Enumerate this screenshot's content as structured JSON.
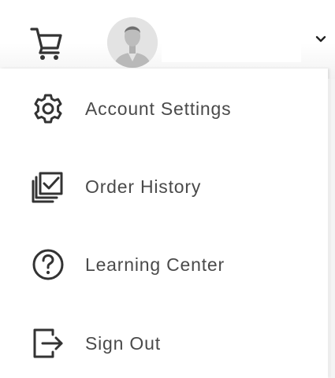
{
  "header": {
    "cart_icon": "shopping-cart-icon",
    "avatar_icon": "user-avatar-icon",
    "user_name": "",
    "dropdown_icon": "chevron-down-icon"
  },
  "menu": {
    "items": [
      {
        "label": "Account Settings",
        "icon": "gear-icon"
      },
      {
        "label": "Order History",
        "icon": "order-history-icon"
      },
      {
        "label": "Learning Center",
        "icon": "help-circle-icon"
      },
      {
        "label": "Sign Out",
        "icon": "sign-out-icon"
      }
    ]
  },
  "colors": {
    "text": "#4a4a4a",
    "icon": "#333333",
    "avatar_bg": "#e3e3e3",
    "avatar_figure": "#b9b9b9"
  }
}
